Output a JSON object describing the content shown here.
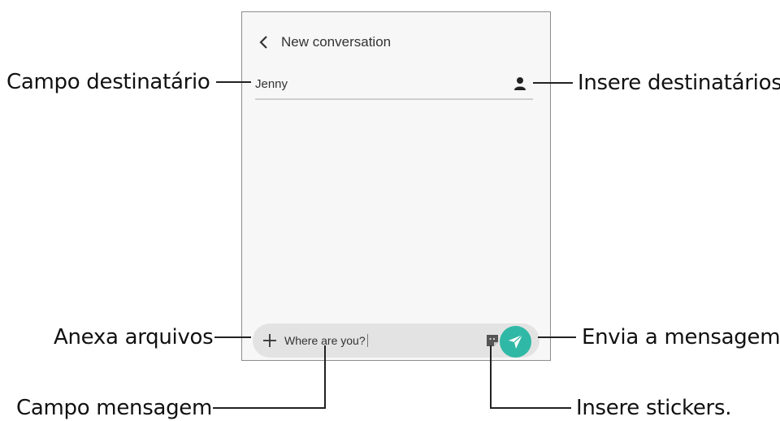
{
  "screen": {
    "header": {
      "title": "New conversation"
    },
    "recipient": {
      "value": "Jenny"
    },
    "composer": {
      "message_value": "Where are you?"
    }
  },
  "callouts": {
    "recipient_field": "Campo destinatário",
    "add_recipients": "Insere destinatários",
    "attach_files": "Anexa arquivos",
    "send_message": "Envia a mensagem",
    "message_field": "Campo mensagem",
    "insert_stickers": "Insere stickers."
  },
  "icons": {
    "back": "chevron-left-icon",
    "contact": "person-icon",
    "attach": "plus-icon",
    "sticker": "sticker-icon",
    "send": "paper-plane-icon"
  },
  "colors": {
    "send_button": "#30b8a6",
    "composer_bg": "#e3e3e3",
    "screen_bg": "#f7f7f7"
  }
}
